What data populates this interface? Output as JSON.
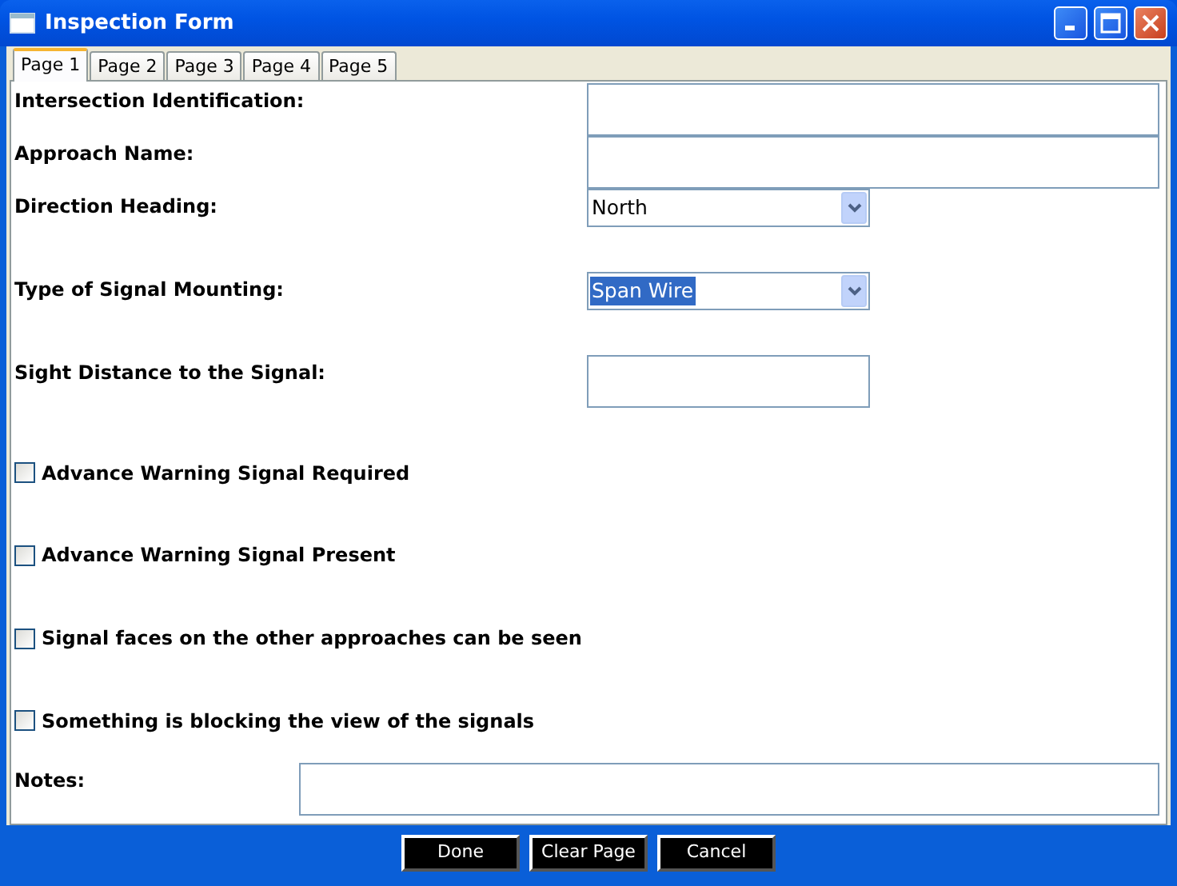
{
  "window": {
    "title": "Inspection Form"
  },
  "tabs": [
    {
      "label": "Page 1",
      "selected": true
    },
    {
      "label": "Page 2",
      "selected": false
    },
    {
      "label": "Page 3",
      "selected": false
    },
    {
      "label": "Page 4",
      "selected": false
    },
    {
      "label": "Page 5",
      "selected": false
    }
  ],
  "fields": [
    {
      "kind": "text",
      "label": "Intersection Identification:"
    },
    {
      "kind": "text",
      "label": "Approach Name:"
    },
    {
      "kind": "select",
      "label": "Direction Heading:",
      "value": "North",
      "focused": false
    },
    {
      "kind": "select",
      "label": "Type of Signal Mounting:",
      "value": "Span Wire",
      "focused": true
    },
    {
      "kind": "shorttext",
      "label": "Sight Distance to the Signal:"
    },
    {
      "kind": "checkbox",
      "label": "Advance Warning Signal Required",
      "checked": false
    },
    {
      "kind": "checkbox",
      "label": "Advance Warning Signal Present",
      "checked": false
    },
    {
      "kind": "checkbox",
      "label": "Signal faces on the other approaches can be seen",
      "checked": false
    },
    {
      "kind": "checkbox",
      "label": "Something is blocking the view of the signals",
      "checked": false
    },
    {
      "kind": "notes",
      "label": "Notes:"
    }
  ],
  "buttons": [
    "Done",
    "Clear Page",
    "Cancel"
  ]
}
